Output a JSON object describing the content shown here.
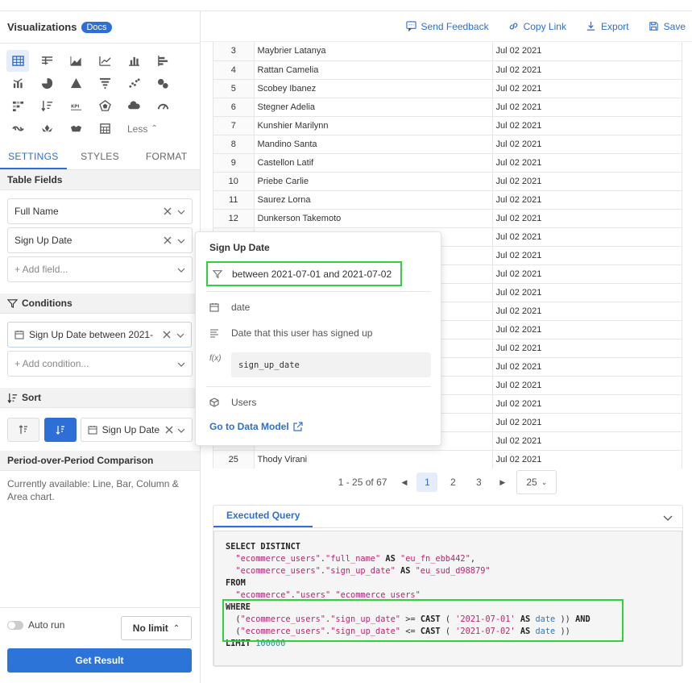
{
  "sidebar": {
    "title": "Visualizations",
    "docs_badge": "Docs",
    "less_label": "Less",
    "tabs": [
      "SETTINGS",
      "STYLES",
      "FORMAT"
    ],
    "table_fields_title": "Table Fields",
    "fields": [
      "Full Name",
      "Sign Up Date"
    ],
    "add_field": "+ Add field...",
    "conditions_title": "Conditions",
    "condition": "Sign Up Date between 2021-",
    "add_condition": "+ Add condition...",
    "sort_title": "Sort",
    "sort_field": "Sign Up Date",
    "pop_title": "Period-over-Period Comparison",
    "pop_text": "Currently available: Line, Bar, Column & Area chart.",
    "autorun": "Auto run",
    "limit": "No limit",
    "get_result": "Get Result"
  },
  "toolbar": {
    "send_feedback": "Send Feedback",
    "copy_link": "Copy Link",
    "export": "Export",
    "save": "Save"
  },
  "table": {
    "rows": [
      [
        "3",
        "Maybrier Latanya",
        "Jul 02 2021"
      ],
      [
        "4",
        "Rattan Camelia",
        "Jul 02 2021"
      ],
      [
        "5",
        "Scobey Ibanez",
        "Jul 02 2021"
      ],
      [
        "6",
        "Stegner Adelia",
        "Jul 02 2021"
      ],
      [
        "7",
        "Kunshier Marilynn",
        "Jul 02 2021"
      ],
      [
        "8",
        "Mandino Santa",
        "Jul 02 2021"
      ],
      [
        "9",
        "Castellon Latif",
        "Jul 02 2021"
      ],
      [
        "10",
        "Priebe Carlie",
        "Jul 02 2021"
      ],
      [
        "11",
        "Saurez Lorna",
        "Jul 02 2021"
      ],
      [
        "12",
        "Dunkerson Takemoto",
        "Jul 02 2021"
      ],
      [
        "",
        "",
        "Jul 02 2021"
      ],
      [
        "",
        "",
        "Jul 02 2021"
      ],
      [
        "",
        "",
        "Jul 02 2021"
      ],
      [
        "",
        "",
        "Jul 02 2021"
      ],
      [
        "",
        "",
        "Jul 02 2021"
      ],
      [
        "",
        "",
        "Jul 02 2021"
      ],
      [
        "",
        "",
        "Jul 02 2021"
      ],
      [
        "",
        "",
        "Jul 02 2021"
      ],
      [
        "",
        "",
        "Jul 02 2021"
      ],
      [
        "",
        "",
        "Jul 02 2021"
      ],
      [
        "",
        "",
        "Jul 02 2021"
      ],
      [
        "",
        "",
        "Jul 02 2021"
      ],
      [
        "25",
        "Thody Virani",
        "Jul 02 2021"
      ]
    ]
  },
  "pager": {
    "info": "1 - 25 of 67",
    "pages": [
      "1",
      "2",
      "3"
    ],
    "current": "1",
    "per_page": "25"
  },
  "query": {
    "tab": "Executed Query"
  },
  "popover": {
    "title": "Sign Up Date",
    "filter": "between 2021-07-01 and 2021-07-02",
    "type": "date",
    "description": "Date that this user has signed up",
    "fx_label": "f(x)",
    "sql_name": "sign_up_date",
    "model": "Users",
    "link": "Go to Data Model"
  }
}
